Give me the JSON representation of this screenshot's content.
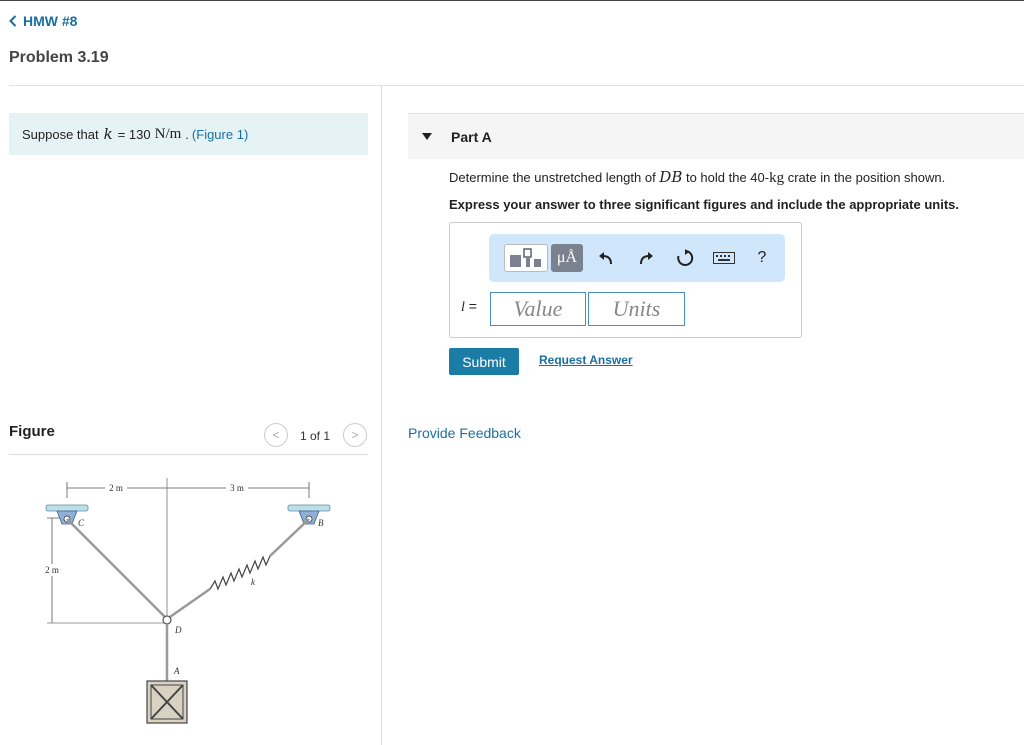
{
  "nav": {
    "back_label": "HMW #8"
  },
  "problem": {
    "title": "Problem 3.19",
    "statement": {
      "prefix": "Suppose that",
      "var": "k",
      "equals": "= 130",
      "unit": "N/m",
      "sep": ".",
      "figure_link": "(Figure 1)"
    }
  },
  "figure": {
    "title": "Figure",
    "pager": "1 of 1",
    "prev_icon": "chevron-left-icon",
    "next_icon": "chevron-right-icon",
    "labels": {
      "dim_left": "2 m",
      "dim_right": "3 m",
      "dim_vertical": "2 m",
      "point_c": "C",
      "point_b": "B",
      "point_d": "D",
      "point_a": "A",
      "spring_k": "k"
    }
  },
  "part": {
    "label": "Part A",
    "question": {
      "t1": "Determine the unstretched length of ",
      "m1": "DB",
      "t2": " to hold the 40-",
      "m2": "kg",
      "t3": " crate in the position shown."
    },
    "instruction": "Express your answer to three significant figures and include the appropriate units.",
    "toolbar": {
      "units_btn": "μÅ",
      "help_btn": "?",
      "icons": [
        "templates-icon",
        "units-icon",
        "undo-icon",
        "redo-icon",
        "reset-icon",
        "keyboard-icon",
        "help-icon"
      ]
    },
    "answer": {
      "var_label": "l",
      "equals": "=",
      "value_placeholder": "Value",
      "units_placeholder": "Units"
    },
    "submit_label": "Submit",
    "request_label": "Request Answer"
  },
  "feedback_label": "Provide Feedback"
}
